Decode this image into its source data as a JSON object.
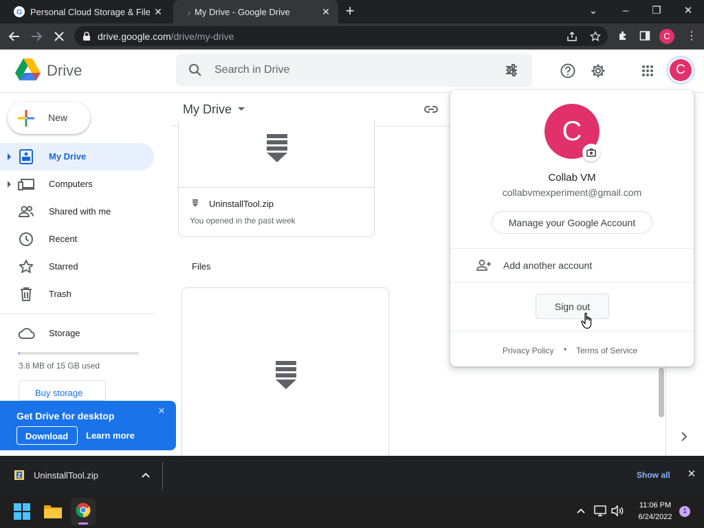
{
  "browser": {
    "tabs": [
      {
        "title": "Personal Cloud Storage & File Sh"
      },
      {
        "title": "My Drive - Google Drive"
      }
    ],
    "url_host": "drive.google.com",
    "url_path": "/drive/my-drive",
    "profile_initial": "C"
  },
  "header": {
    "app_name": "Drive",
    "search_placeholder": "Search in Drive",
    "avatar_initial": "C"
  },
  "sidebar": {
    "new_label": "New",
    "items": [
      {
        "label": "My Drive",
        "icon": "my-drive-icon",
        "active": true
      },
      {
        "label": "Computers",
        "icon": "computers-icon"
      },
      {
        "label": "Shared with me",
        "icon": "shared-icon"
      },
      {
        "label": "Recent",
        "icon": "clock-icon"
      },
      {
        "label": "Starred",
        "icon": "star-icon"
      },
      {
        "label": "Trash",
        "icon": "trash-icon"
      }
    ],
    "storage_label": "Storage",
    "storage_used_text": "3.8 MB of 15 GB used",
    "storage_used_fraction": 0.0003,
    "buy_storage_label": "Buy storage"
  },
  "promo": {
    "title": "Get Drive for desktop",
    "download_label": "Download",
    "learn_more_label": "Learn more"
  },
  "main": {
    "location_title": "My Drive",
    "suggested_file": {
      "name": "UninstallTool.zip",
      "subtitle": "You opened in the past week"
    },
    "files_heading": "Files"
  },
  "account_popup": {
    "avatar_initial": "C",
    "name": "Collab VM",
    "email": "collabvmexperiment@gmail.com",
    "manage_label": "Manage your Google Account",
    "add_account_label": "Add another account",
    "sign_out_label": "Sign out",
    "privacy_label": "Privacy Policy",
    "separator": "•",
    "terms_label": "Terms of Service"
  },
  "download_bar": {
    "file_name": "UninstallTool.zip",
    "show_all_label": "Show all"
  },
  "taskbar": {
    "time": "11:06 PM",
    "date": "6/24/2022",
    "notification_count": "1"
  },
  "colors": {
    "accent": "#1a73e8",
    "avatar": "#e0316b",
    "active_nav_bg": "#e8f0fe"
  }
}
